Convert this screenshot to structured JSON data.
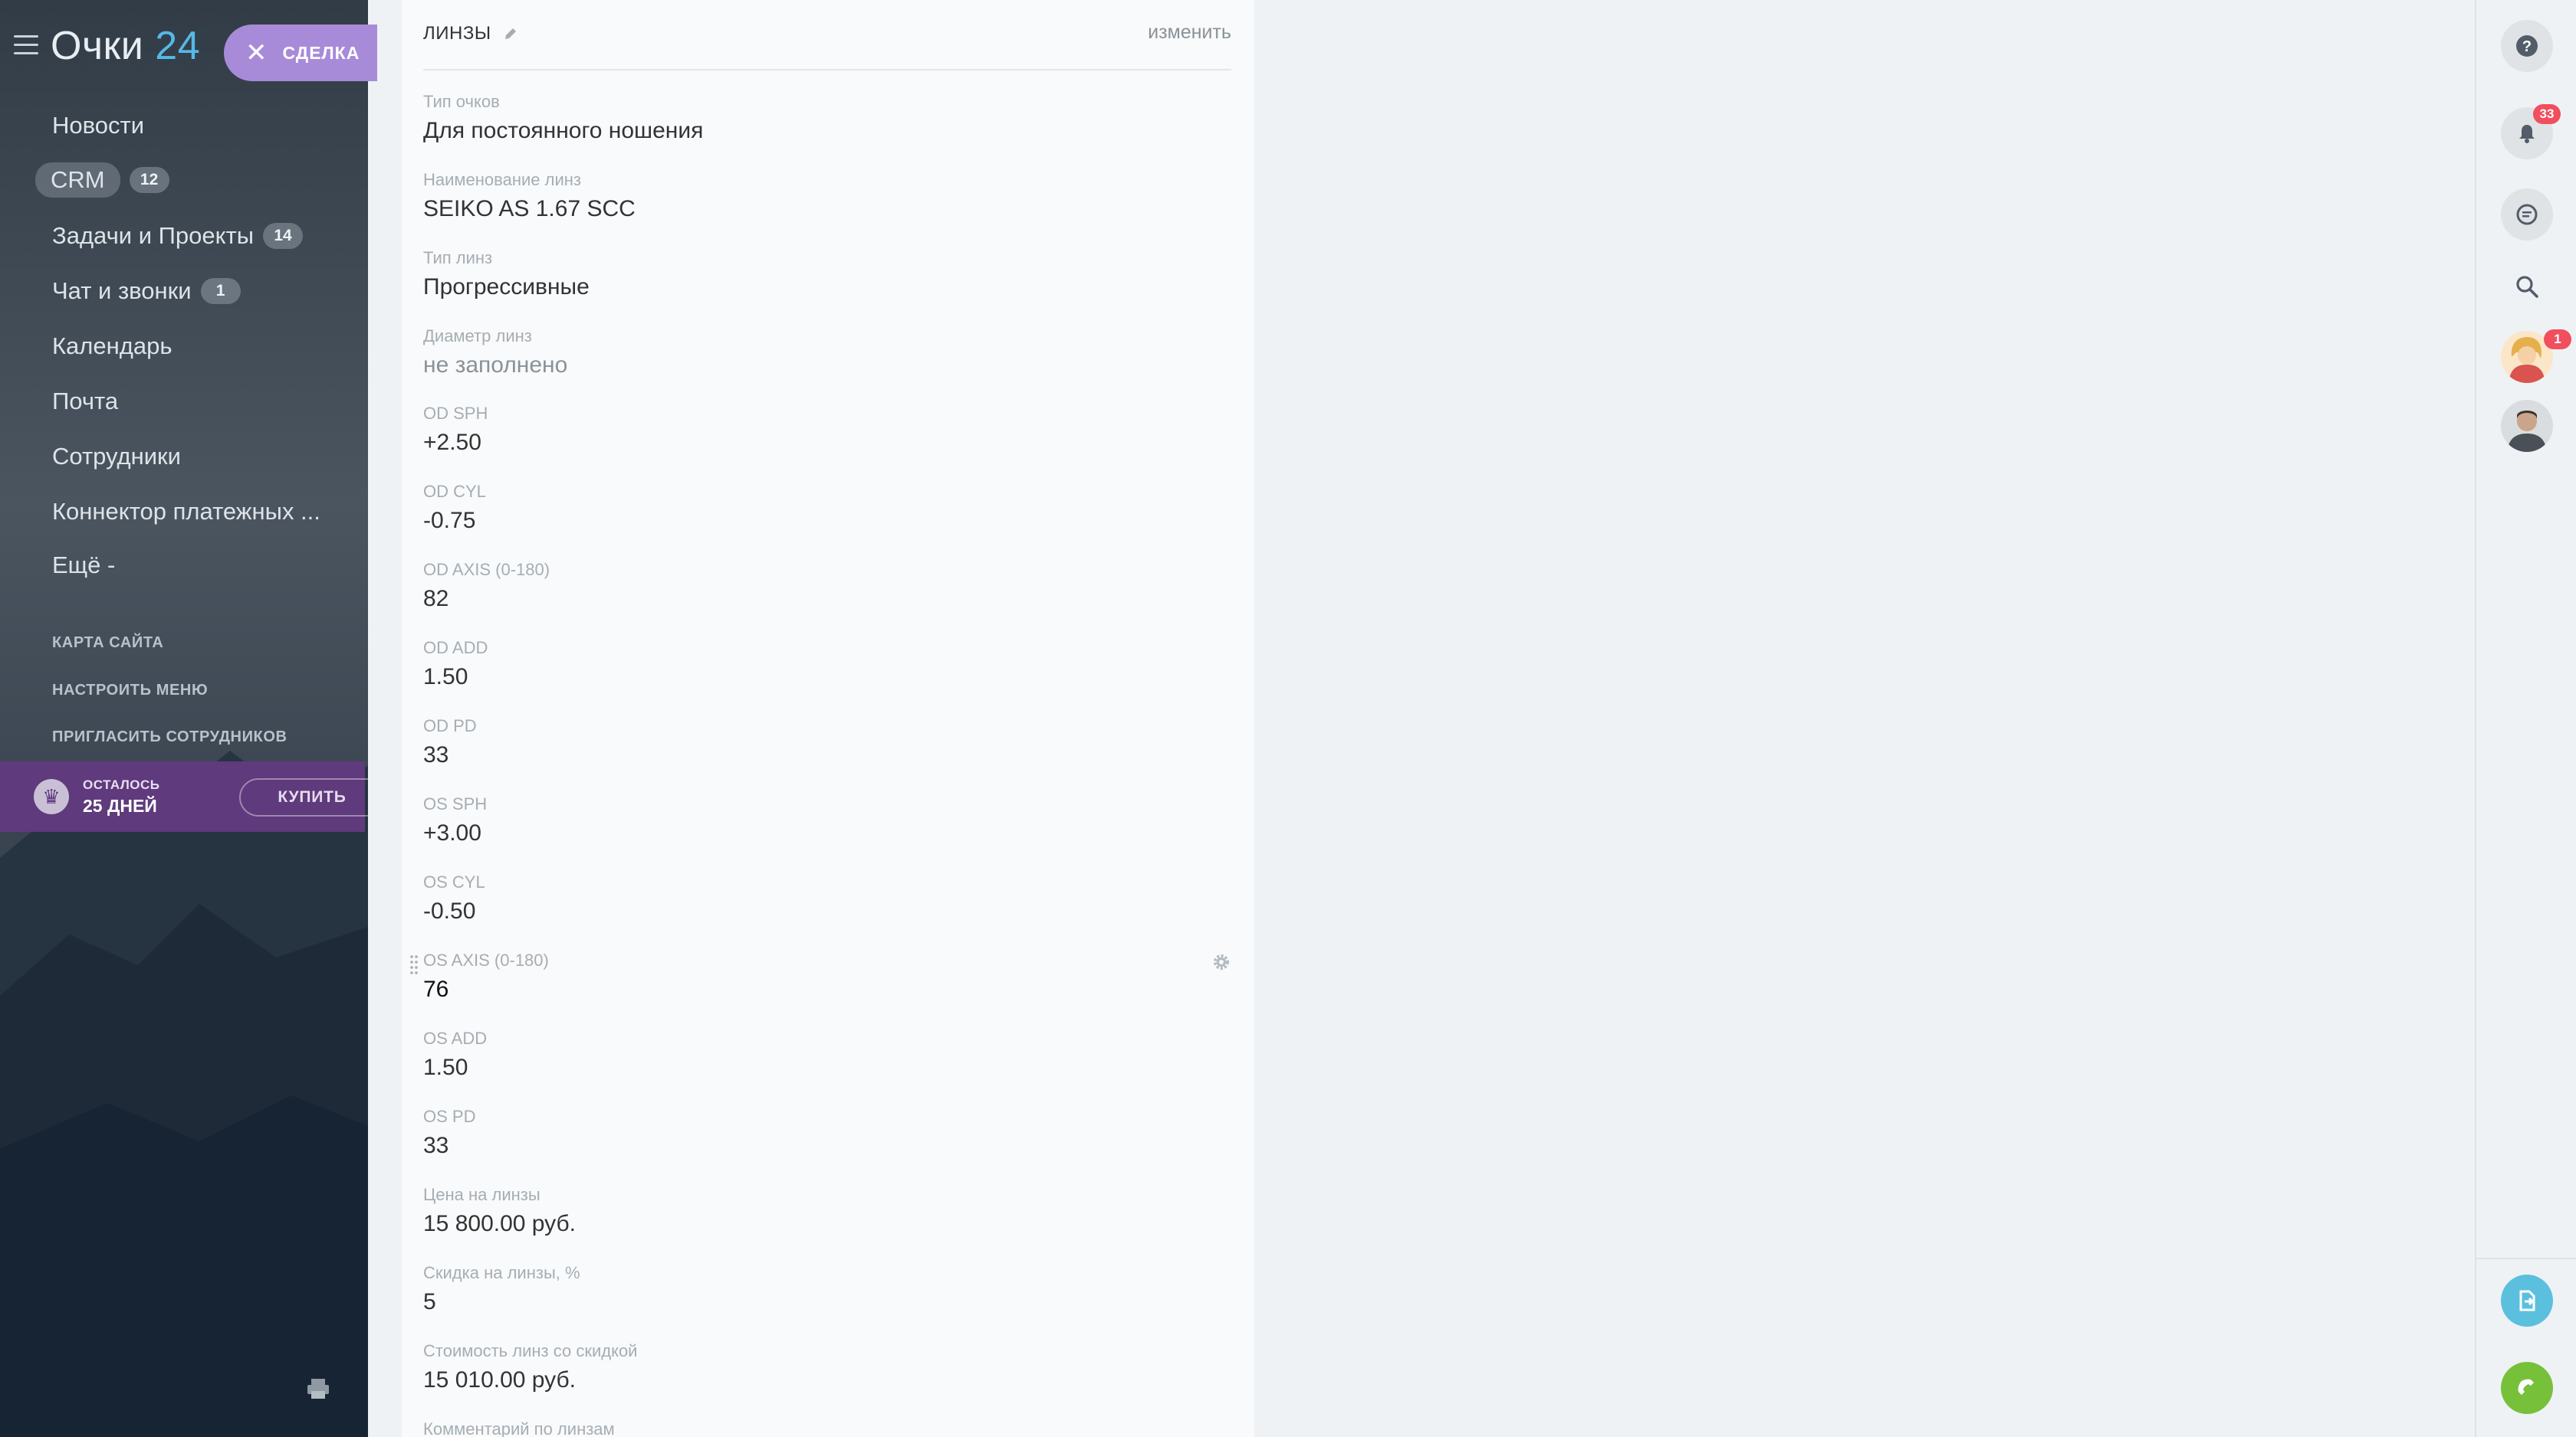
{
  "app": {
    "logo_text": "Очки",
    "logo_number": "24"
  },
  "deal_pill": {
    "label": "СДЕЛКА"
  },
  "sidebar": {
    "items": [
      {
        "label": "Новости"
      },
      {
        "label": "CRM",
        "counter": "12"
      },
      {
        "label": "Задачи и Проекты",
        "counter": "14"
      },
      {
        "label": "Чат и звонки",
        "counter": "1"
      },
      {
        "label": "Календарь"
      },
      {
        "label": "Почта"
      },
      {
        "label": "Сотрудники"
      },
      {
        "label": "Коннектор платежных ..."
      },
      {
        "label": "Ещё -"
      }
    ],
    "links": [
      {
        "label": "КАРТА САЙТА"
      },
      {
        "label": "НАСТРОИТЬ МЕНЮ"
      },
      {
        "label": "ПРИГЛАСИТЬ СОТРУДНИКОВ"
      }
    ],
    "trial": {
      "line1": "ОСТАЛОСЬ",
      "line2": "25 ДНЕЙ",
      "buy_label": "КУПИТЬ"
    }
  },
  "card": {
    "title": "ЛИНЗЫ",
    "edit_label": "изменить",
    "fields": [
      {
        "label": "Тип очков",
        "value": "Для постоянного ношения"
      },
      {
        "label": "Наименование линз",
        "value": "SEIKO AS 1.67 SCC"
      },
      {
        "label": "Тип линз",
        "value": "Прогрессивные"
      },
      {
        "label": "Диаметр линз",
        "value": "не заполнено"
      },
      {
        "label": "OD SPH",
        "value": "+2.50"
      },
      {
        "label": "OD CYL",
        "value": "-0.75"
      },
      {
        "label": "OD AXIS (0-180)",
        "value": "82"
      },
      {
        "label": "OD ADD",
        "value": "1.50"
      },
      {
        "label": "OD PD",
        "value": "33"
      },
      {
        "label": "OS SPH",
        "value": "+3.00"
      },
      {
        "label": "OS CYL",
        "value": "-0.50"
      },
      {
        "label": "OS AXIS (0-180)",
        "value": "76"
      },
      {
        "label": "OS ADD",
        "value": "1.50"
      },
      {
        "label": "OS PD",
        "value": "33"
      },
      {
        "label": "Цена на линзы",
        "value": "15 800.00 руб."
      },
      {
        "label": "Скидка на линзы, %",
        "value": "5"
      },
      {
        "label": "Стоимость линз со скидкой",
        "value": "15 010.00 руб."
      },
      {
        "label": "Комментарий по линзам",
        "value": ""
      }
    ]
  },
  "right_panel": {
    "notifications_count": "33",
    "avatar1_badge": "1"
  },
  "colors": {
    "deal_pill": "#a78bd8",
    "trial_bg": "#5f3a7c",
    "badge": "#f14e5e",
    "phone_btn": "#77c13a",
    "doc_btn": "#5bc0de",
    "logo_accent": "#55b9e8"
  },
  "icons": {
    "help": "question-icon",
    "notifications": "bell-icon",
    "chat": "chat-icon",
    "search": "search-icon",
    "doc": "document-icon",
    "phone": "phone-icon",
    "print": "printer-icon",
    "edit": "pencil-icon",
    "settings": "gear-icon",
    "menu": "hamburger-icon",
    "close": "close-icon",
    "crown": "crown-icon"
  }
}
